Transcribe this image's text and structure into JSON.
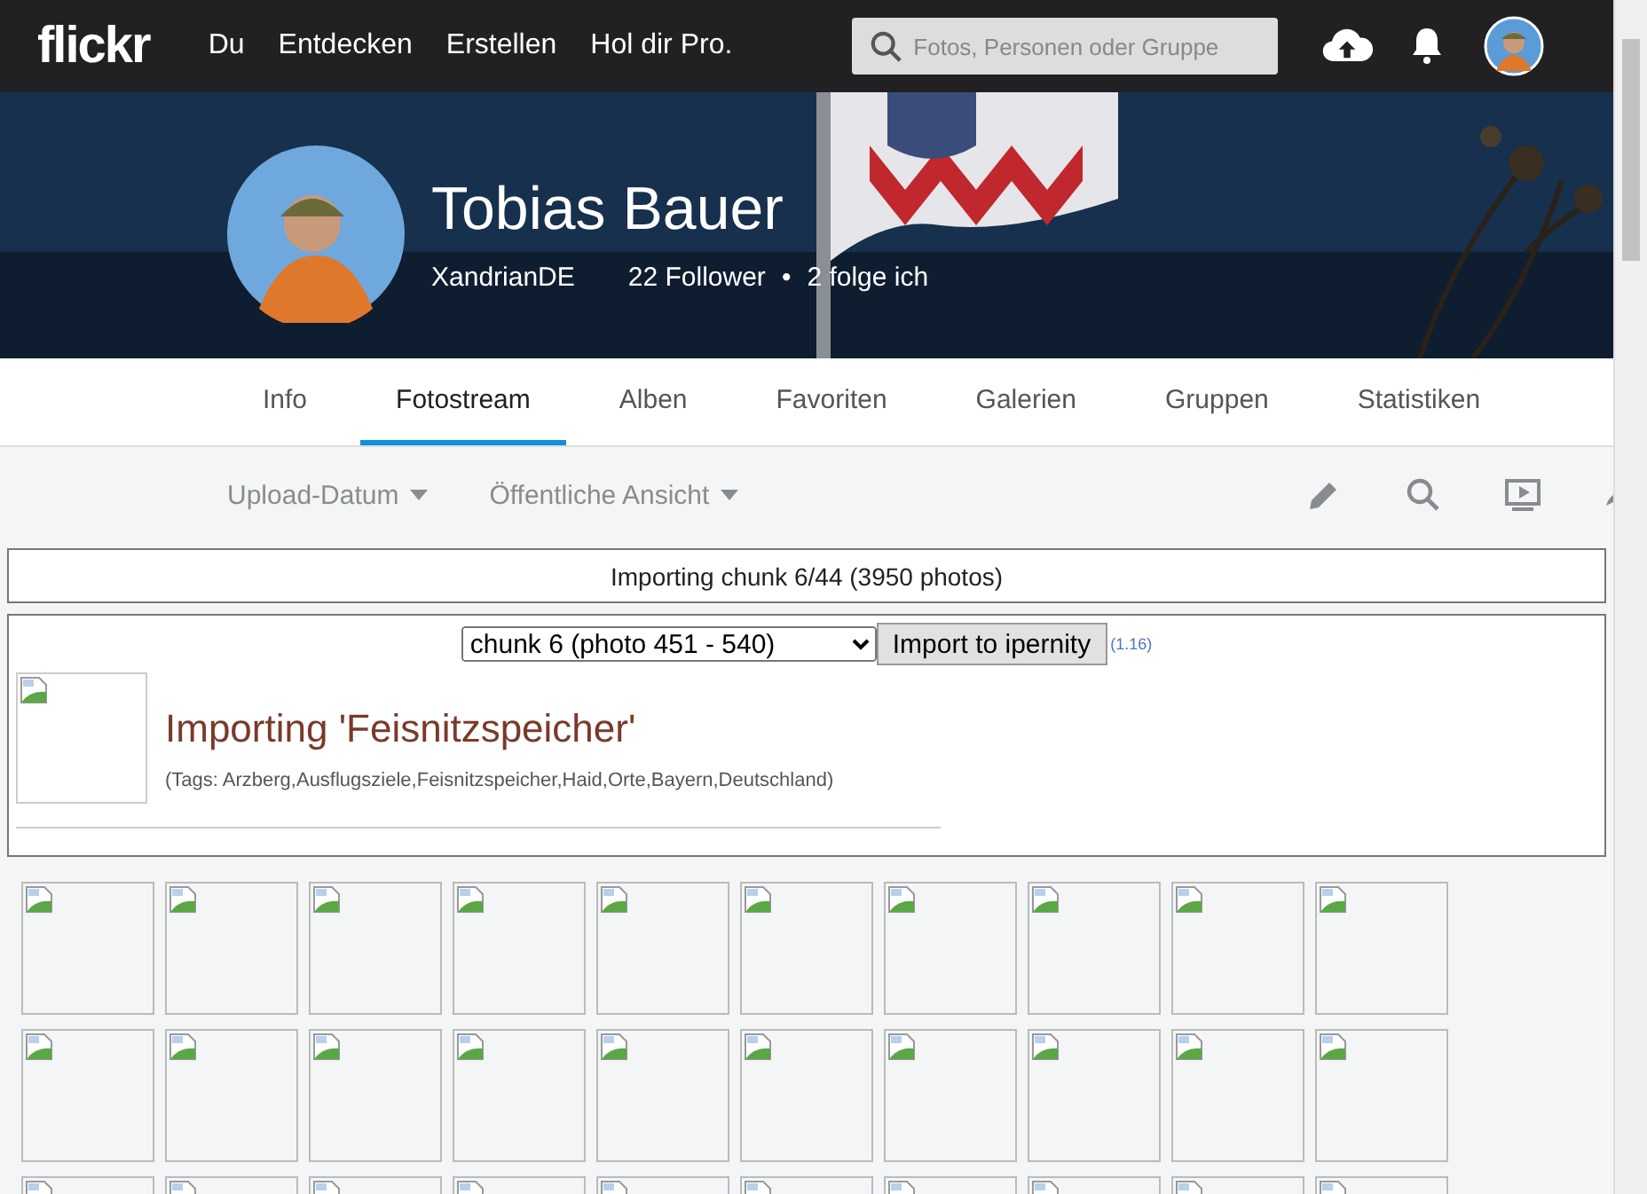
{
  "nav": {
    "logo": "flickr",
    "links": [
      "Du",
      "Entdecken",
      "Erstellen",
      "Hol dir Pro."
    ],
    "search": {
      "placeholder": "Fotos, Personen oder Gruppe"
    }
  },
  "profile": {
    "name": "Tobias Bauer",
    "username": "XandrianDE",
    "followers": "22 Follower",
    "separator": "•",
    "following": "2 folge ich"
  },
  "tabs": [
    {
      "label": "Info",
      "selected": false
    },
    {
      "label": "Fotostream",
      "selected": true
    },
    {
      "label": "Alben",
      "selected": false
    },
    {
      "label": "Favoriten",
      "selected": false
    },
    {
      "label": "Galerien",
      "selected": false
    },
    {
      "label": "Gruppen",
      "selected": false
    },
    {
      "label": "Statistiken",
      "selected": false
    }
  ],
  "filters": [
    "Upload-Datum",
    "Öffentliche Ansicht"
  ],
  "status": "Importing chunk 6/44 (3950 photos)",
  "importer": {
    "chunk_select": "chunk 6 (photo 451 - 540)",
    "button": "Import to ipernity",
    "version": "(1.16)",
    "title": "Importing 'Feisnitzspeicher'",
    "tags": "(Tags: Arzberg,Ausflugsziele,Feisnitzspeicher,Haid,Orte,Bayern,Deutschland)"
  },
  "thumbnails": [
    {
      "kind": "broken-image"
    },
    {
      "kind": "broken-image"
    },
    {
      "kind": "broken-image"
    },
    {
      "kind": "broken-image"
    },
    {
      "kind": "broken-image"
    },
    {
      "kind": "broken-image"
    },
    {
      "kind": "broken-image"
    },
    {
      "kind": "broken-image"
    },
    {
      "kind": "broken-image"
    },
    {
      "kind": "broken-image"
    },
    {
      "kind": "broken-image"
    },
    {
      "kind": "broken-image"
    },
    {
      "kind": "broken-image"
    },
    {
      "kind": "broken-image"
    },
    {
      "kind": "broken-image"
    },
    {
      "kind": "broken-image"
    },
    {
      "kind": "broken-image"
    },
    {
      "kind": "broken-image"
    },
    {
      "kind": "broken-image"
    },
    {
      "kind": "broken-image"
    },
    {
      "kind": "broken-image"
    },
    {
      "kind": "broken-image"
    },
    {
      "kind": "broken-image"
    },
    {
      "kind": "broken-image"
    },
    {
      "kind": "broken-image"
    },
    {
      "kind": "broken-image"
    },
    {
      "kind": "broken-image"
    },
    {
      "kind": "broken-image"
    },
    {
      "kind": "broken-image"
    },
    {
      "kind": "broken-image"
    }
  ]
}
